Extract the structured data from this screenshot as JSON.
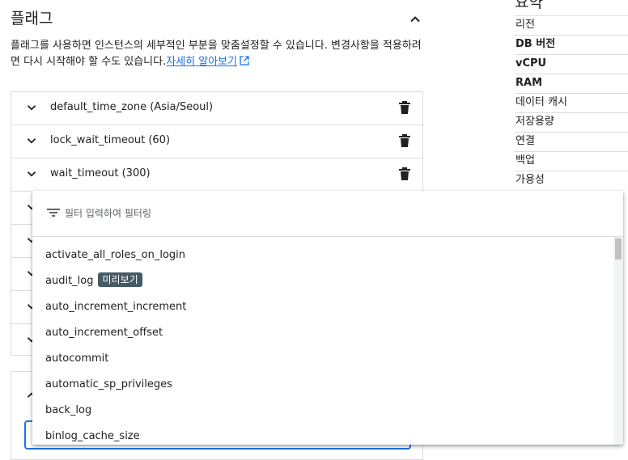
{
  "flags_section": {
    "title": "플래그",
    "description": "플래그를 사용하면 인스턴스의 세부적인 부분을 맞춤설정할 수 있습니다. 변경사항을 적용하려면 다시 시작해야 할 수도 있습니다.",
    "learn_more": "자세히 알아보기",
    "flags": [
      {
        "label": "default_time_zone (Asia/Seoul)"
      },
      {
        "label": "lock_wait_timeout (60)"
      },
      {
        "label": "wait_timeout (300)"
      }
    ]
  },
  "summary": {
    "heading": "요약",
    "items": [
      {
        "label": "리전",
        "bold": false
      },
      {
        "label": "DB 버전",
        "bold": true
      },
      {
        "label": "vCPU",
        "bold": true
      },
      {
        "label": "RAM",
        "bold": true
      },
      {
        "label": "데이터 캐시",
        "bold": false
      },
      {
        "label": "저장용량",
        "bold": false
      },
      {
        "label": "연결",
        "bold": false
      },
      {
        "label": "백업",
        "bold": false
      },
      {
        "label": "가용성",
        "bold": false
      }
    ]
  },
  "dropdown": {
    "filter_placeholder": "필터 입력하여 필터링",
    "options": [
      {
        "label": "activate_all_roles_on_login",
        "badge": ""
      },
      {
        "label": "audit_log",
        "badge": "미리보기"
      },
      {
        "label": "auto_increment_increment",
        "badge": ""
      },
      {
        "label": "auto_increment_offset",
        "badge": ""
      },
      {
        "label": "autocommit",
        "badge": ""
      },
      {
        "label": "automatic_sp_privileges",
        "badge": ""
      },
      {
        "label": "back_log",
        "badge": ""
      },
      {
        "label": "binlog_cache_size",
        "badge": ""
      }
    ]
  },
  "colors": {
    "link": "#1a73e8",
    "badge_bg": "#455a64",
    "border": "#dadce0"
  }
}
